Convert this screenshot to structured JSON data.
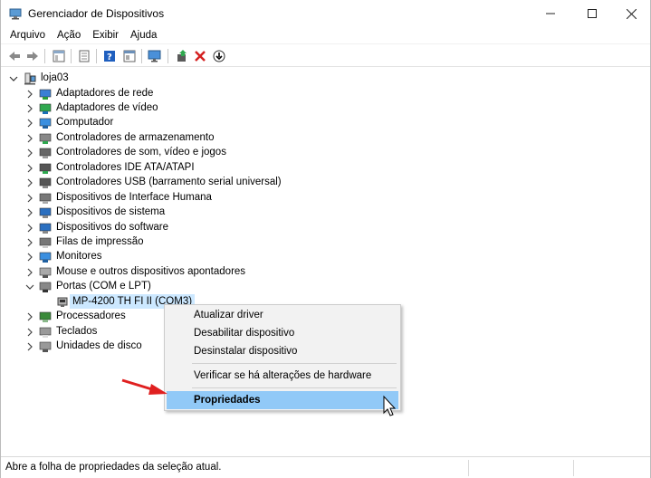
{
  "window": {
    "title": "Gerenciador de Dispositivos"
  },
  "menubar": [
    "Arquivo",
    "Ação",
    "Exibir",
    "Ajuda"
  ],
  "tree": {
    "root": "loja03",
    "categories": [
      {
        "label": "Adaptadores de rede",
        "icon": "network-adapter-icon"
      },
      {
        "label": "Adaptadores de vídeo",
        "icon": "display-adapter-icon"
      },
      {
        "label": "Computador",
        "icon": "computer-icon"
      },
      {
        "label": "Controladores de armazenamento",
        "icon": "storage-controller-icon"
      },
      {
        "label": "Controladores de som, vídeo e jogos",
        "icon": "speaker-icon"
      },
      {
        "label": "Controladores IDE ATA/ATAPI",
        "icon": "ide-controller-icon"
      },
      {
        "label": "Controladores USB (barramento serial universal)",
        "icon": "usb-icon"
      },
      {
        "label": "Dispositivos de Interface Humana",
        "icon": "hid-icon"
      },
      {
        "label": "Dispositivos de sistema",
        "icon": "system-device-icon"
      },
      {
        "label": "Dispositivos do software",
        "icon": "software-device-icon"
      },
      {
        "label": "Filas de impressão",
        "icon": "printer-icon"
      },
      {
        "label": "Monitores",
        "icon": "monitor-icon"
      },
      {
        "label": "Mouse e outros dispositivos apontadores",
        "icon": "mouse-icon"
      },
      {
        "label": "Portas (COM e LPT)",
        "icon": "port-icon"
      },
      {
        "label": "Processadores",
        "icon": "processor-icon"
      },
      {
        "label": "Teclados",
        "icon": "keyboard-icon"
      },
      {
        "label": "Unidades de disco",
        "icon": "disk-drive-icon"
      }
    ],
    "selected_child": "MP-4200 TH FI II (COM3)"
  },
  "context_menu": {
    "update_driver": "Atualizar driver",
    "disable": "Desabilitar dispositivo",
    "uninstall": "Desinstalar dispositivo",
    "scan": "Verificar se há alterações de hardware",
    "properties": "Propriedades"
  },
  "statusbar": {
    "text": "Abre a folha de propriedades da seleção atual."
  },
  "colors": {
    "selection": "#cce8ff",
    "menu_highlight": "#91c9f7",
    "annotation_arrow": "#e02020"
  }
}
